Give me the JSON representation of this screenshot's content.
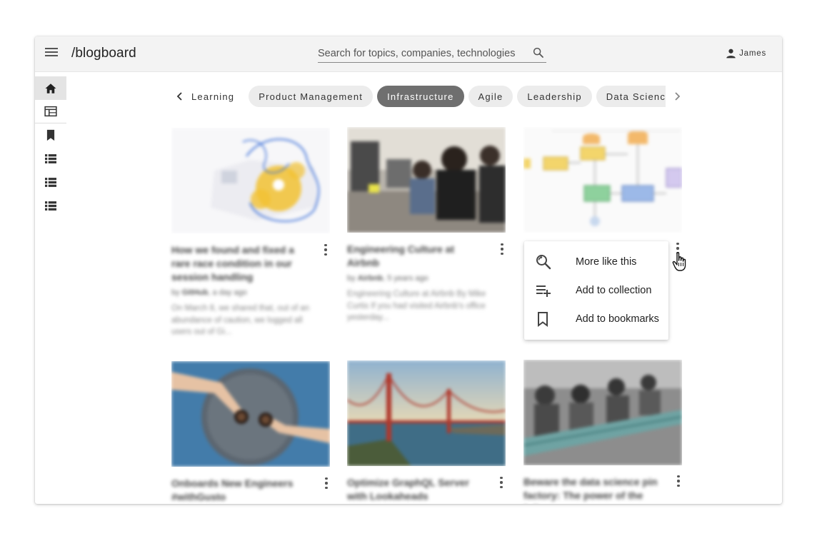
{
  "header": {
    "menu_icon": "hamburger-menu-icon",
    "brand": "/blogboard",
    "search_placeholder": "Search for topics, companies, technologies",
    "search_icon": "magnifier-icon",
    "user_icon": "person-icon",
    "user_name": "James"
  },
  "sidebar": {
    "items": [
      {
        "icon": "home-icon",
        "active": true
      },
      {
        "icon": "dashboard-icon",
        "active": false
      },
      {
        "icon": "bookmark-icon",
        "active": false
      },
      {
        "icon": "list-icon",
        "active": false
      },
      {
        "icon": "list-icon",
        "active": false
      },
      {
        "icon": "list-icon",
        "active": false
      }
    ]
  },
  "tags": {
    "prev_icon": "chevron-left-icon",
    "next_icon": "chevron-right-icon",
    "items": [
      "Learning",
      "Product Management",
      "Infrastructure",
      "Agile",
      "Leadership",
      "Data Science"
    ],
    "selected": "Infrastructure"
  },
  "cards": [
    {
      "title": "How we found and fixed a rare race condition in our session handling",
      "company": "GitHub",
      "age": ", a day ago",
      "by": "by ",
      "excerpt": "On March 8, we shared that, out of an abundance of caution, we logged all users out of Gi..."
    },
    {
      "title": "Engineering Culture at Airbnb",
      "company": "Airbnb",
      "age": ", 5 years ago",
      "by": "by ",
      "excerpt": "Engineering Culture at Airbnb By Mike Curtis If you had visited Airbnb's office yesterday..."
    },
    {
      "title": "",
      "company": "",
      "age": "",
      "by": "",
      "excerpt": ""
    },
    {
      "title": "Onboards New Engineers #withGusto"
    },
    {
      "title": "Optimize GraphQL Server with Lookaheads"
    },
    {
      "title": "Beware the data science pin factory: The power of the full-"
    }
  ],
  "context_menu": {
    "items": [
      {
        "label": "More like this",
        "icon": "search-related-icon"
      },
      {
        "label": "Add to collection",
        "icon": "playlist-add-icon"
      },
      {
        "label": "Add to bookmarks",
        "icon": "bookmark-outline-icon"
      }
    ]
  },
  "colors": {
    "header_bg": "#f3f3f3",
    "chip_bg": "#ececec",
    "chip_active_bg": "#6f6f6f",
    "accent_blue": "#3b6fd8",
    "accent_yellow": "#f2c233"
  }
}
